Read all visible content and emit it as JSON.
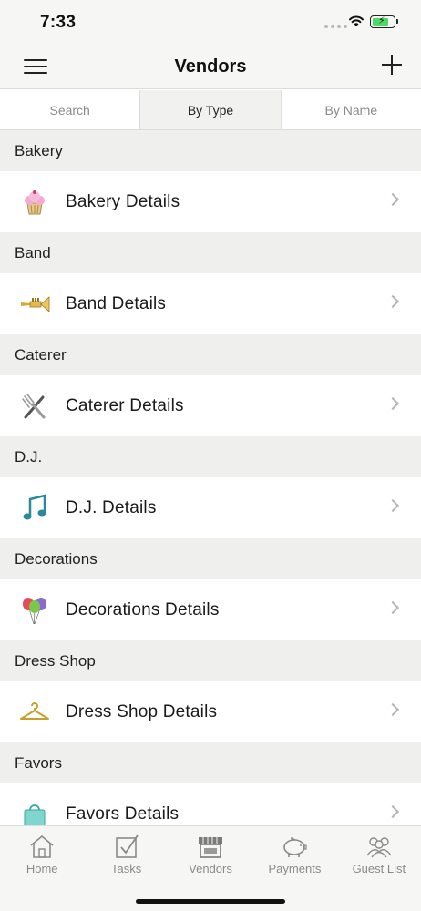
{
  "status_bar": {
    "time": "7:33"
  },
  "nav": {
    "title": "Vendors"
  },
  "segments": [
    {
      "label": "Search"
    },
    {
      "label": "By Type"
    },
    {
      "label": "By Name"
    }
  ],
  "sections": [
    {
      "header": "Bakery",
      "row_label": "Bakery Details",
      "icon": "cupcake-icon"
    },
    {
      "header": "Band",
      "row_label": "Band Details",
      "icon": "trumpet-icon"
    },
    {
      "header": "Caterer",
      "row_label": "Caterer Details",
      "icon": "utensils-icon"
    },
    {
      "header": "D.J.",
      "row_label": "D.J. Details",
      "icon": "music-note-icon"
    },
    {
      "header": "Decorations",
      "row_label": "Decorations Details",
      "icon": "balloons-icon"
    },
    {
      "header": "Dress Shop",
      "row_label": "Dress Shop Details",
      "icon": "hanger-icon"
    },
    {
      "header": "Favors",
      "row_label": "Favors Details",
      "icon": "gift-bag-icon"
    }
  ],
  "tab_bar": {
    "tabs": [
      {
        "label": "Home",
        "icon": "home-icon"
      },
      {
        "label": "Tasks",
        "icon": "checkbox-icon"
      },
      {
        "label": "Vendors",
        "icon": "storefront-icon"
      },
      {
        "label": "Payments",
        "icon": "piggy-bank-icon"
      },
      {
        "label": "Guest List",
        "icon": "people-icon"
      }
    ]
  },
  "colors": {
    "bar_bg": "#f6f6f4",
    "section_bg": "#efefee",
    "battery_green": "#4cd964",
    "tab_gray": "#8a8a8a"
  }
}
